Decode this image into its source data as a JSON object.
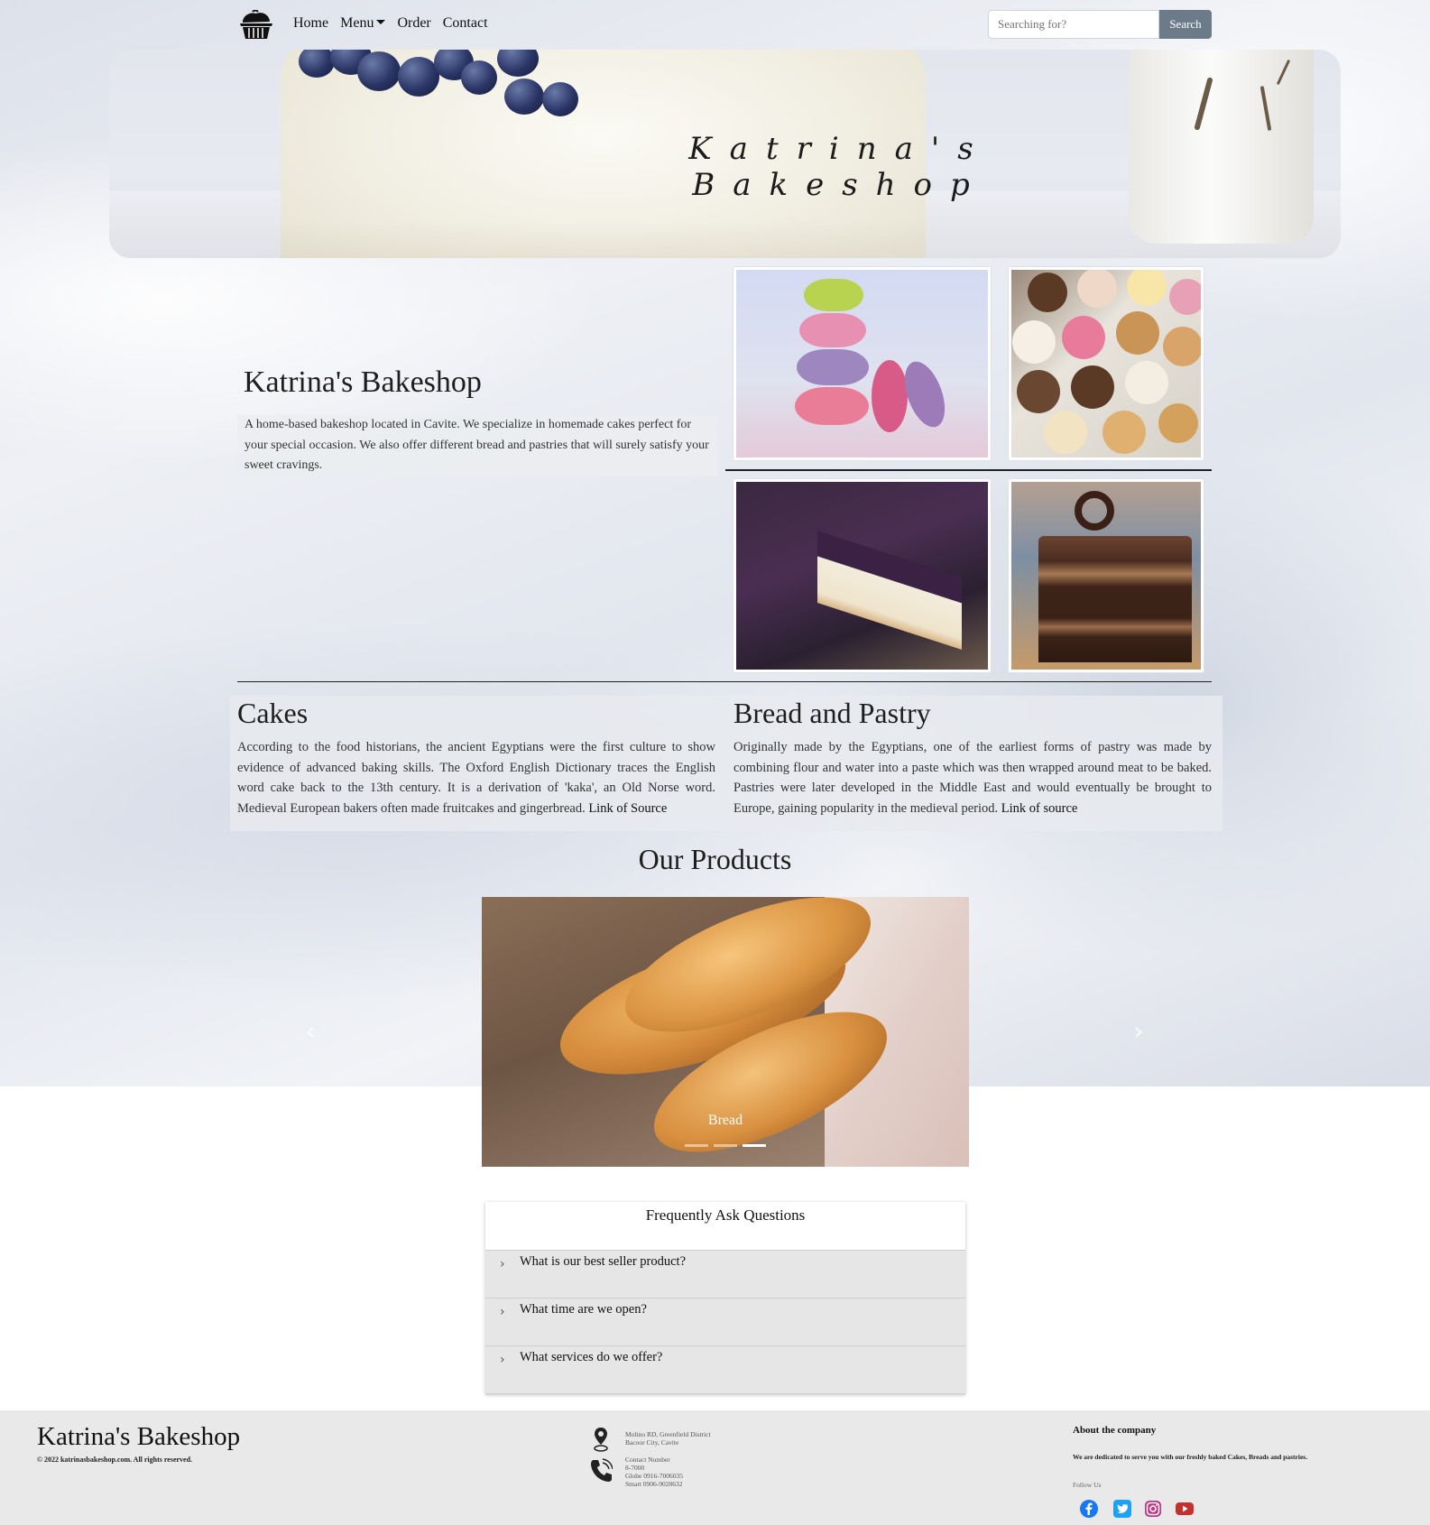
{
  "nav": {
    "links": [
      "Home",
      "Menu",
      "Order",
      "Contact"
    ],
    "search_placeholder": "Searching for?",
    "search_button": "Search"
  },
  "hero": {
    "title_line1": "Katrina's",
    "title_line2": "Bakeshop"
  },
  "intro": {
    "title": "Katrina's Bakeshop",
    "text": "A home-based bakeshop located in Cavite. We specialize in homemade cakes perfect for your special occasion. We also offer different bread and pastries that will surely satisfy your sweet cravings."
  },
  "sections": {
    "cakes": {
      "title": "Cakes",
      "text": "According to the food historians, the ancient Egyptians were the first culture to show evidence of advanced baking skills. The Oxford English Dictionary traces the English word cake back to the 13th century. It is a derivation of 'kaka', an Old Norse word. Medieval European bakers often made fruitcakes and gingerbread.",
      "link": "Link of Source"
    },
    "bread": {
      "title": "Bread and Pastry",
      "text": "Originally made by the Egyptians, one of the earliest forms of pastry was made by combining flour and water into a paste which was then wrapped around meat to be baked. Pastries were later developed in the Middle East and would eventually be brought to Europe, gaining popularity in the medieval period.",
      "link": "Link of source"
    }
  },
  "products": {
    "title": "Our Products",
    "caption": "Bread",
    "prev_icon": "chevron-left-icon",
    "next_icon": "chevron-right-icon",
    "active_slide": 3,
    "slide_count": 3
  },
  "faq": {
    "title": "Frequently Ask Questions",
    "items": [
      "What is our best seller product?",
      "What time are we open?",
      "What services do we offer?"
    ]
  },
  "footer": {
    "brand": "Katrina's Bakeshop",
    "copyright": "© 2022 katrinasbakeshop.com. All rights reserved.",
    "address_line1": "Molino RD, Greenfield District",
    "address_line2": "Bacoor City, Cavite",
    "contact_label": "Contact Number",
    "contact_landline": "8-7000",
    "contact_globe": "Globe 0916-7006035",
    "contact_smart": "Smart 0906-9028632",
    "about_heading": "About the company",
    "about_text": "We are dedicated to serve you with our freshly baked Cakes, Breads and pastries.",
    "follow_label": "Follow Us",
    "socials": [
      "facebook-icon",
      "twitter-icon",
      "instagram-icon",
      "youtube-icon"
    ]
  },
  "colors": {
    "search_button": "#6c7b8a",
    "footer_bg": "#e9e9e9",
    "facebook": "#1877f2",
    "twitter": "#1da1f2",
    "instagram": "#c13584",
    "youtube": "#c4302b"
  }
}
